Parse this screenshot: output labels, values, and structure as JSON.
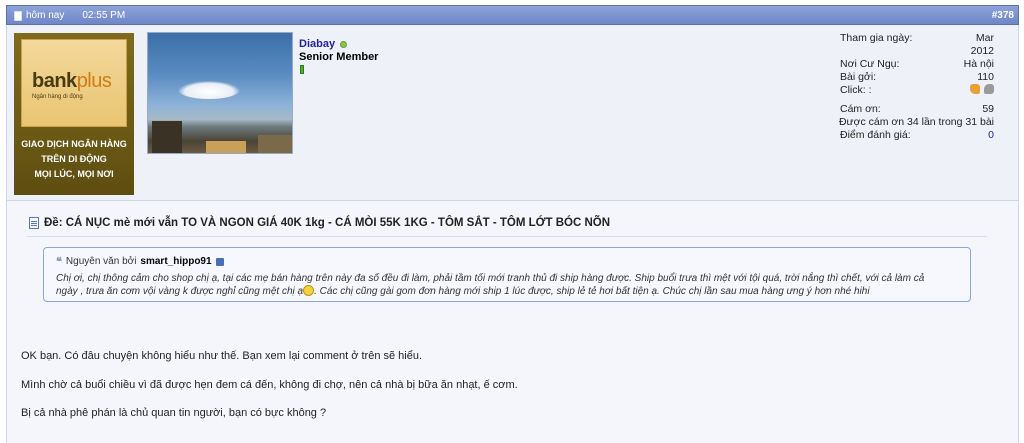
{
  "post": {
    "date": "hôm nay",
    "time": "02:55 PM",
    "number": "#378"
  },
  "banner": {
    "logo_main": "bank",
    "logo_plus": "plus",
    "logo_sub": "Ngân hàng di động",
    "tagline_1": "GIAO DỊCH NGÂN HÀNG",
    "tagline_2": "TRÊN DI ĐỘNG",
    "tagline_3": "MỌI LÚC, MỌI NƠI"
  },
  "user": {
    "name": "Diabay",
    "title": "Senior Member"
  },
  "stats": {
    "join_label": "Tham gia ngày:",
    "join_month": "Mar",
    "join_year": "2012",
    "location_label": "Nơi Cư Ngụ:",
    "location_value": "Hà nội",
    "posts_label": "Bài gởi:",
    "posts_value": "110",
    "click_label": "Click: :",
    "thanks_label": "Cám ơn:",
    "thanks_value": "59",
    "thanked_text": "Được cám ơn 34 lần trong 31 bài",
    "rating_label": "Điểm đánh giá:",
    "rating_value": "0"
  },
  "message": {
    "title": "Đề: CÁ NỤC mè mới vẫn TO VÀ NGON GIÁ 40K 1kg - CÁ MÒI 55K 1KG - TÔM SẮT - TÔM LỚT BÓC NÕN",
    "quote_prefix": "Nguyên văn bởi",
    "quote_author": "smart_hippo91",
    "quote_line1": "Chị ơi, chị thông cảm cho shop chị ạ, tại các mẹ bán hàng trên này đa số đều đi làm, phải tầm tối mới tranh thủ đi ship hàng được. Ship buổi trưa thì mệt với tội quá, trời nắng thì chết, với cả làm cả",
    "quote_line2a": "ngày , trưa ăn cơm vội vàng k được nghỉ cũng mệt chị ạ",
    "quote_line2b": ". Các chị cũng gài gom đơn hàng mới ship 1 lúc được, ship lẻ tẻ hơi bất tiện ạ. Chúc chị lần sau mua hàng ưng ý hơn nhé hihi",
    "body_1": "OK bạn. Có đâu chuyện không hiểu như thế. Bạn xem lại comment ở trên sẽ hiểu.",
    "body_2": "Mình chờ cả buổi chiều vì đã được hẹn đem cá đến, không đi chợ, nên cả nhà bị bữa ăn nhạt, ế cơm.",
    "body_3": "Bị cả nhà phê phán là chủ quan tin người, bạn có bực không ?"
  },
  "colors": {
    "header_bar": "#7a8fd0",
    "username": "#22229c",
    "quote_border": "#8aa6d6"
  }
}
